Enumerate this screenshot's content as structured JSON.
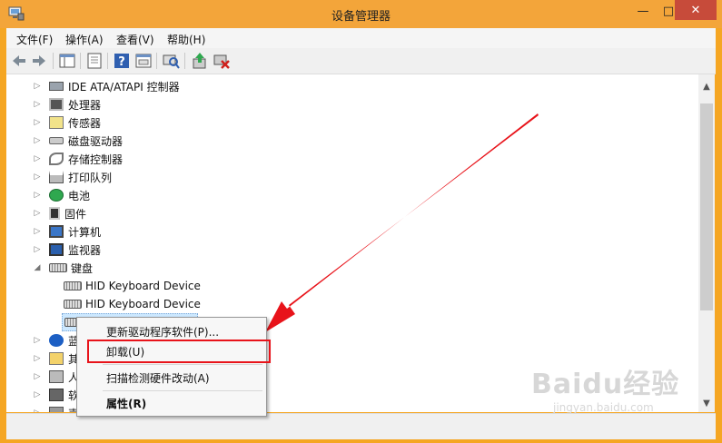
{
  "window": {
    "title": "设备管理器",
    "controls": {
      "minimize": "—",
      "maximize": "□",
      "close": "✕"
    }
  },
  "menubar": {
    "items": [
      {
        "label": "文件(F)"
      },
      {
        "label": "操作(A)"
      },
      {
        "label": "查看(V)"
      },
      {
        "label": "帮助(H)"
      }
    ]
  },
  "toolbar": {
    "buttons": [
      "back-icon",
      "forward-icon",
      "show-hide-tree-icon",
      "properties-icon",
      "help-icon",
      "view-icon",
      "scan-hardware-icon",
      "update-driver-icon",
      "uninstall-icon"
    ]
  },
  "tree": {
    "items": [
      {
        "label": "IDE ATA/ATAPI 控制器",
        "expanded": false,
        "icon": "ide-controller-icon"
      },
      {
        "label": "处理器",
        "expanded": false,
        "icon": "processor-icon"
      },
      {
        "label": "传感器",
        "expanded": false,
        "icon": "sensor-icon"
      },
      {
        "label": "磁盘驱动器",
        "expanded": false,
        "icon": "disk-drive-icon"
      },
      {
        "label": "存储控制器",
        "expanded": false,
        "icon": "storage-controller-icon"
      },
      {
        "label": "打印队列",
        "expanded": false,
        "icon": "printer-icon"
      },
      {
        "label": "电池",
        "expanded": false,
        "icon": "battery-icon"
      },
      {
        "label": "固件",
        "expanded": false,
        "icon": "firmware-icon"
      },
      {
        "label": "计算机",
        "expanded": false,
        "icon": "computer-icon"
      },
      {
        "label": "监视器",
        "expanded": false,
        "icon": "monitor-icon"
      },
      {
        "label": "键盘",
        "expanded": true,
        "icon": "keyboard-icon"
      }
    ],
    "keyboard_children": [
      {
        "label": "HID Keyboard Device"
      },
      {
        "label": "HID Keyboard Device"
      }
    ],
    "partial_items": [
      {
        "label": "蓝"
      },
      {
        "label": "其"
      },
      {
        "label": "人"
      },
      {
        "label": "软"
      },
      {
        "label": "声"
      }
    ]
  },
  "context_menu": {
    "items": [
      {
        "label": "更新驱动程序软件(P)..."
      },
      {
        "label": "卸载(U)"
      },
      {
        "label": "扫描检测硬件改动(A)"
      },
      {
        "label": "属性(R)"
      }
    ]
  },
  "watermark": {
    "brand": "Baidu经验",
    "url": "jingyan.baidu.com"
  },
  "colors": {
    "titlebar": "#f3a53a",
    "close_button": "#c74b3a",
    "annotation": "#e8131a"
  }
}
